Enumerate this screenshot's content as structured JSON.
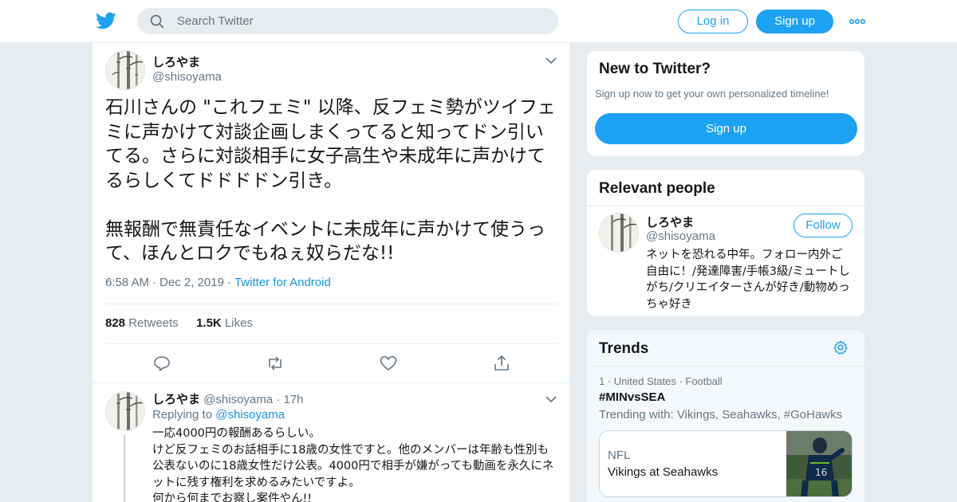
{
  "header": {
    "search_placeholder": "Search Twitter",
    "login_label": "Log in",
    "signup_label": "Sign up",
    "logo_icon": "twitter-bird-icon",
    "more_icon": "more-dots-icon"
  },
  "tweet": {
    "author_name": "しろやま",
    "author_handle": "@shisoyama",
    "text": "石川さんの \"これフェミ\" 以降、反フェミ勢がツイフェミに声かけて対談企画しまくってると知ってドン引いてる。さらに対談相手に女子高生や未成年に声かけてるらしくてドドドドン引き。\n\n無報酬で無責任なイベントに未成年に声かけて使うって、ほんとロクでもねぇ奴らだな!!",
    "time": "6:58 AM",
    "date": "Dec 2, 2019",
    "source": "Twitter for Android",
    "retweets_count": "828",
    "retweets_label": "Retweets",
    "likes_count": "1.5K",
    "likes_label": "Likes"
  },
  "reply": {
    "author_name": "しろやま",
    "author_handle": "@shisoyama",
    "time_ago": "17h",
    "replying_prefix": "Replying to",
    "replying_to": "@shisoyama",
    "text": "一応4000円の報酬あるらしい。\nけど反フェミのお話相手に18歳の女性ですと。他のメンバーは年齢も性別も公表ないのに18歳女性だけ公表。4000円で相手が嫌がっても動画を永久にネットに残す権利を求めるみたいですよ。\n何から何までお察し案件やん!!"
  },
  "sidebar": {
    "new_title": "New to Twitter?",
    "new_subtitle": "Sign up now to get your own personalized timeline!",
    "new_signup_label": "Sign up",
    "relevant_title": "Relevant people",
    "person": {
      "name": "しろやま",
      "handle": "@shisoyama",
      "follow_label": "Follow",
      "bio": "ネットを恐れる中年。フォロー内外ご自由に！/発達障害/手帳3級/ミュートしがち/クリエイターさんが好き/動物めっちゃ好き"
    },
    "trends_title": "Trends",
    "trend": {
      "meta": "1 · United States · Football",
      "name": "#MINvsSEA",
      "trending_with": "Trending with: Vikings, Seahawks, #GoHawks",
      "news_category": "NFL",
      "news_title": "Vikings at Seahawks"
    }
  },
  "colors": {
    "accent": "#1da1f2",
    "link": "#1b95e0",
    "secondary_text": "#657786",
    "background": "#e6ecf0"
  }
}
